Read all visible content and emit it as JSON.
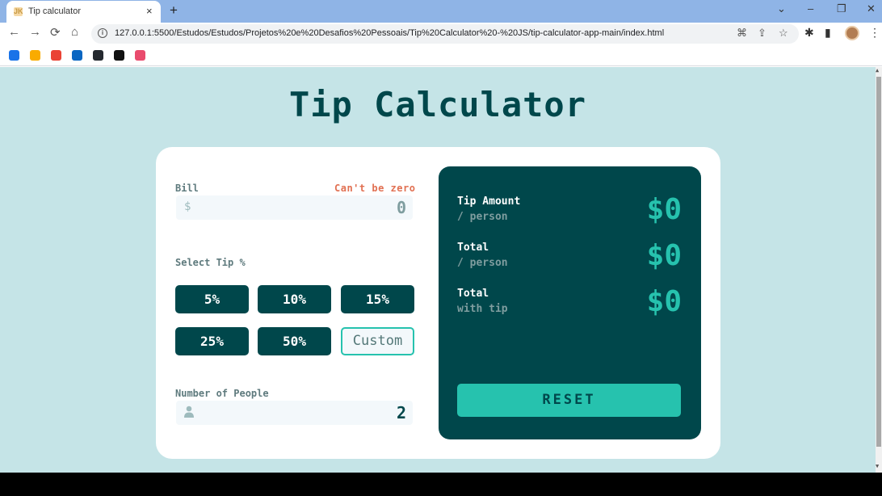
{
  "browser": {
    "tab_title": "Tip calculator",
    "tab_favicon": "JK",
    "new_tab": "+",
    "tab_close": "×",
    "url": "127.0.0.1:5500/Estudos/Estudos/Projetos%20e%20Desafios%20Pessoais/Tip%20Calculator%20-%20JS/tip-calculator-app-main/index.html",
    "window": {
      "minimize": "–",
      "restore": "❐",
      "close": "✕",
      "tab_search": "⌄"
    },
    "nav": {
      "back": "←",
      "forward": "→",
      "reload": "⟳",
      "home": "⌂"
    },
    "bookmarks": [
      {
        "name": "edge",
        "color": "#1a73e8"
      },
      {
        "name": "google-drive",
        "color": "#f9ab00"
      },
      {
        "name": "gmail",
        "color": "#ea4335"
      },
      {
        "name": "linkedin",
        "color": "#0a66c2"
      },
      {
        "name": "github",
        "color": "#24292f"
      },
      {
        "name": "medium",
        "color": "#111111"
      },
      {
        "name": "extension",
        "color": "#e94b6d"
      }
    ]
  },
  "app": {
    "title": "Tip Calculator",
    "bill": {
      "label": "Bill",
      "error": "Can't be zero",
      "icon": "$",
      "value": "0"
    },
    "tip": {
      "label": "Select Tip %",
      "options": [
        "5%",
        "10%",
        "15%",
        "25%",
        "50%"
      ],
      "custom_placeholder": "Custom"
    },
    "people": {
      "label": "Number of People",
      "icon": "person-icon",
      "value": "2"
    },
    "results": {
      "tip_amount": {
        "label": "Tip Amount",
        "sub": "/ person",
        "value": "$0"
      },
      "total_person": {
        "label": "Total",
        "sub": "/ person",
        "value": "$0"
      },
      "total_tip": {
        "label": "Total",
        "sub": "with tip",
        "value": "$0"
      },
      "reset": "RESET"
    },
    "colors": {
      "dark": "#00474b",
      "accent": "#26c2ae",
      "background": "#c5e4e7",
      "error": "#e17052"
    }
  }
}
